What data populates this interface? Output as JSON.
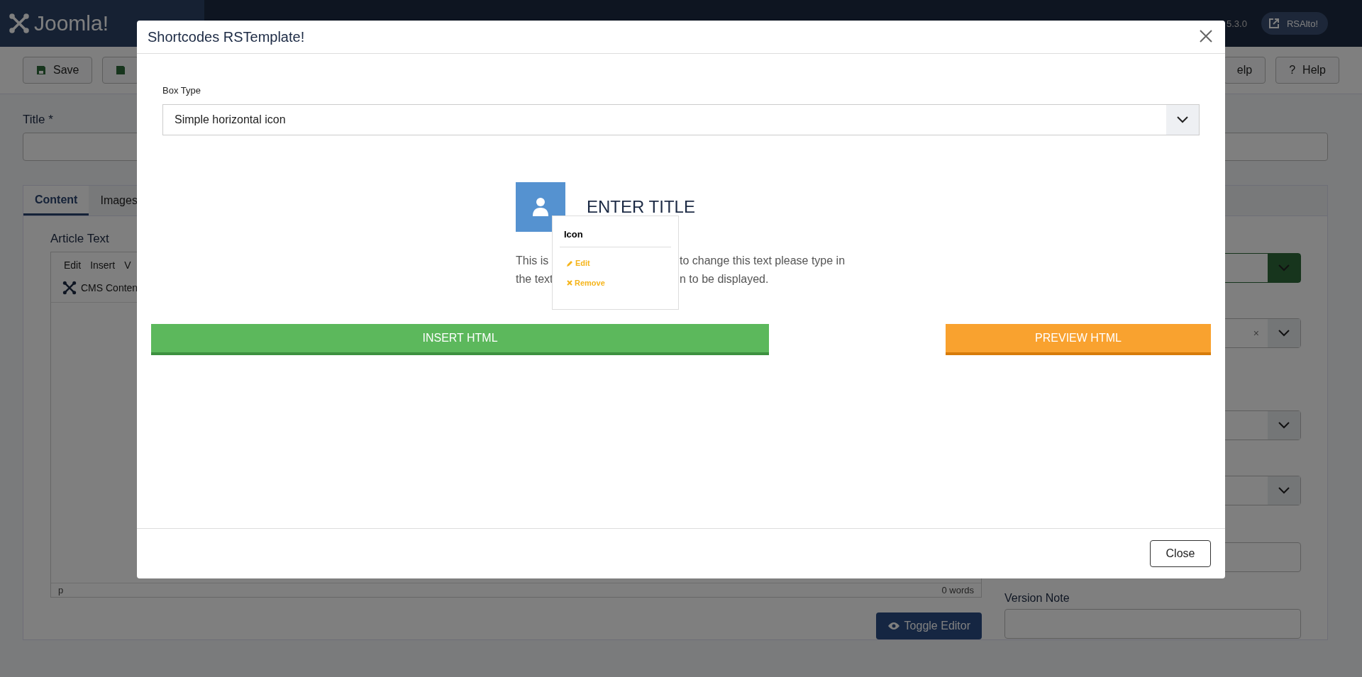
{
  "header": {
    "logo": "Joomla!",
    "version": "5.3.0",
    "user_button": "RSAlto!"
  },
  "toolbar": {
    "save_button": "Save",
    "help_fragment": "elp",
    "help_icon": "?",
    "help_button": "Help"
  },
  "form": {
    "title_label": "Title *",
    "tabs": [
      {
        "label": "Content",
        "selected": true
      },
      {
        "label": "Images",
        "selected": false
      }
    ],
    "editor": {
      "label": "Article Text",
      "menus": [
        "Edit",
        "Insert",
        "V"
      ],
      "plugin_button": "CMS Conten",
      "path": "p",
      "word_count": "0 words",
      "toggle_button": "Toggle Editor"
    },
    "side_fields": [
      {
        "kind": "select",
        "highlighted": true
      },
      {
        "kind": "select",
        "highlighted": false,
        "clear": "×"
      },
      {
        "kind": "select",
        "highlighted": false
      },
      {
        "kind": "select",
        "highlighted": false
      },
      {
        "kind": "input"
      },
      {
        "kind": "input",
        "label": "Version Note"
      }
    ]
  },
  "modal": {
    "title": "Shortcodes RSTemplate!",
    "box_type_label": "Box Type",
    "box_type_value": "Simple horizontal icon",
    "preview": {
      "title": "ENTER TITLE",
      "lines": [
        [
          "This is",
          "to change this text please type in"
        ],
        [
          "the text",
          "n to be displayed."
        ]
      ]
    },
    "popup": {
      "title": "Icon",
      "actions": [
        {
          "kind": "edit",
          "label": "Edit"
        },
        {
          "kind": "remove",
          "label": "Remove"
        }
      ]
    },
    "insert_button": "INSERT HTML",
    "preview_button": "PREVIEW HTML",
    "close_button": "Close"
  }
}
